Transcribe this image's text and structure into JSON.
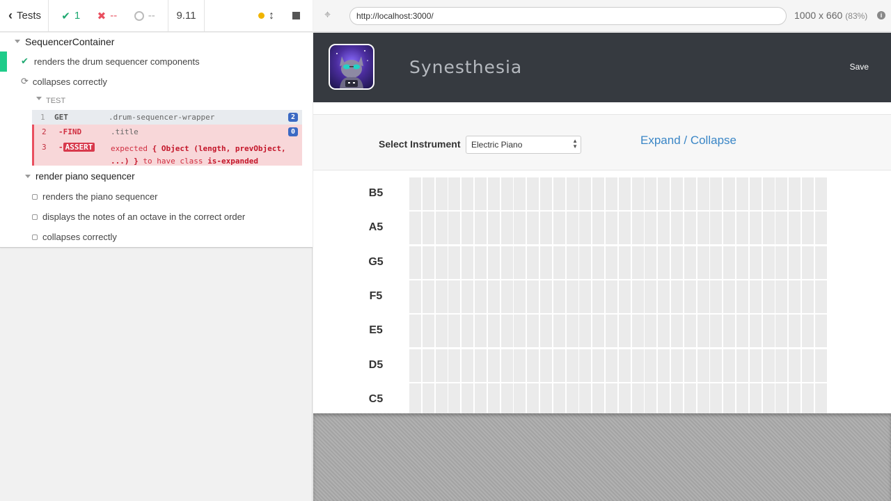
{
  "runner": {
    "back_label": "Tests",
    "stats": {
      "passed": "1",
      "failed": "--",
      "pending": "--"
    },
    "duration": "9.11",
    "suite": {
      "title": "SequencerContainer",
      "tests": [
        {
          "label": "renders the drum sequencer components",
          "state": "passed"
        },
        {
          "label": "collapses correctly",
          "state": "running"
        }
      ],
      "command_log": {
        "header": "TEST",
        "commands": [
          {
            "num": "1",
            "name": "GET",
            "message": ".drum-sequencer-wrapper",
            "badge": "2"
          },
          {
            "num": "2",
            "name": "-FIND",
            "message": ".title",
            "badge": "0"
          },
          {
            "num": "3",
            "name": "-",
            "tag": "ASSERT",
            "msg_expected": "expected",
            "msg_object": "{ Object (length, prevObject,",
            "msg_object2": "...) }",
            "msg_tohave": "to have class",
            "msg_class": "is-expanded"
          }
        ]
      },
      "subsuite": {
        "title": "render piano sequencer",
        "tests": [
          {
            "label": "renders the piano sequencer"
          },
          {
            "label": "displays the notes of an octave in the correct order"
          },
          {
            "label": "collapses correctly"
          }
        ]
      }
    }
  },
  "aut_bar": {
    "url": "http://localhost:3000/",
    "viewport": "1000 x 660",
    "scale": "(83%)",
    "info": "i"
  },
  "app": {
    "title": "Synesthesia",
    "save_label": "Save",
    "select_instrument_label": "Select Instrument",
    "instrument_value": "Electric Piano",
    "expand_label": "Expand / Collapse",
    "notes": [
      "B5",
      "A5",
      "G5",
      "F5",
      "E5",
      "D5",
      "C5"
    ],
    "steps_per_row": 32
  }
}
